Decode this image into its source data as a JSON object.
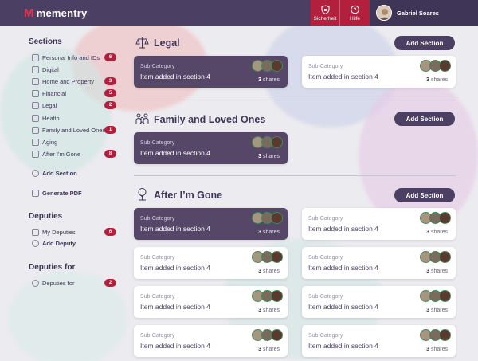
{
  "app": {
    "name": "mementry",
    "logo_glyph": "M"
  },
  "topbar": {
    "security_label": "Sicherheit",
    "help_label": "Hilfe",
    "user_name": "Gabriel Soares"
  },
  "sidebar": {
    "sections_heading": "Sections",
    "items": [
      {
        "label": "Personal Info and IDs",
        "badge": "6",
        "icon": "id-card-icon"
      },
      {
        "label": "Digital",
        "badge": "",
        "icon": "image-icon"
      },
      {
        "label": "Home and Property",
        "badge": "3",
        "icon": "house-icon"
      },
      {
        "label": "Financial",
        "badge": "5",
        "icon": "money-icon"
      },
      {
        "label": "Legal",
        "badge": "2",
        "icon": "scale-icon"
      },
      {
        "label": "Health",
        "badge": "",
        "icon": "health-icon"
      },
      {
        "label": "Family and Loved Ones",
        "badge": "1",
        "icon": "family-icon"
      },
      {
        "label": "Aging",
        "badge": "",
        "icon": "aging-icon"
      },
      {
        "label": "After I'm Gone",
        "badge": "8",
        "icon": "tree-icon"
      }
    ],
    "add_section": "Add Section",
    "generate_pdf": "Generate PDF",
    "deputies_heading": "Deputies",
    "my_deputies": "My Deputies",
    "my_deputies_badge": "6",
    "add_deputy": "Add Deputy",
    "deputies_for_heading": "Deputies for",
    "deputies_for": "Deputies for",
    "deputies_for_badge": "2"
  },
  "main": {
    "add_section_label": "Add Section",
    "card_sub": "Sub-Category",
    "card_text": "Item added in section 4",
    "shares_count": "3",
    "shares_word": "shares",
    "sections": [
      {
        "title": "Legal"
      },
      {
        "title": "Family and Loved Ones"
      },
      {
        "title": "After I’m Gone"
      }
    ]
  },
  "colors": {
    "primary": "#4b3f63",
    "accent": "#b3203e",
    "dark_card": "#564769"
  }
}
